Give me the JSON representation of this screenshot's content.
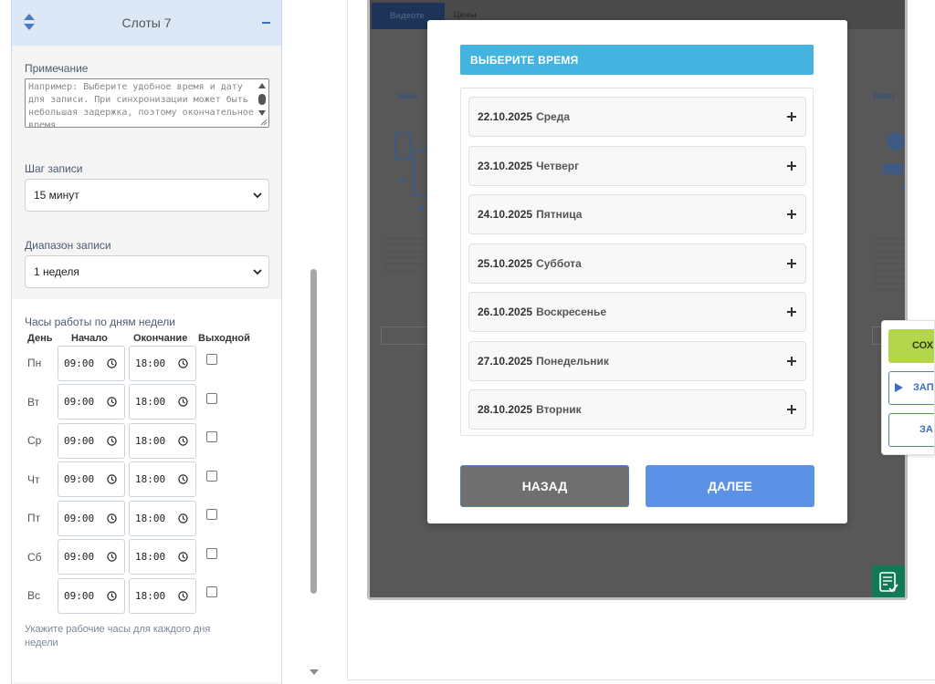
{
  "left_panel": {
    "slot_title": "Слоты 7",
    "note": {
      "label": "Примечание",
      "placeholder": "Например: Выберите удобное время и дату для записи. При синхронизации может быть небольшая задержка, поэтому окончательное время"
    },
    "step": {
      "label": "Шаг записи",
      "value": "15 минут"
    },
    "range": {
      "label": "Диапазон записи",
      "value": "1 неделя"
    },
    "hours": {
      "label": "Часы работы по дням недели",
      "columns": [
        "День",
        "Начало",
        "Окончание",
        "Выходной"
      ],
      "days": [
        {
          "day": "Пн",
          "start": "09:00",
          "end": "18:00"
        },
        {
          "day": "Вт",
          "start": "09:00",
          "end": "18:00"
        },
        {
          "day": "Ср",
          "start": "09:00",
          "end": "18:00"
        },
        {
          "day": "Чт",
          "start": "09:00",
          "end": "18:00"
        },
        {
          "day": "Пт",
          "start": "09:00",
          "end": "18:00"
        },
        {
          "day": "Сб",
          "start": "09:00",
          "end": "18:00"
        },
        {
          "day": "Вс",
          "start": "09:00",
          "end": "18:00"
        }
      ],
      "hint": "Укажите рабочие часы для каждого дня недели"
    }
  },
  "preview": {
    "tabs": [
      "Видеоте",
      "Цены"
    ],
    "card_left_title": "Банн",
    "card_right_title": "Темат"
  },
  "modal": {
    "title": "ВЫБЕРИТЕ ВРЕМЯ",
    "dates": [
      {
        "date": "22.10.2025",
        "weekday": "Среда"
      },
      {
        "date": "23.10.2025",
        "weekday": "Четверг"
      },
      {
        "date": "24.10.2025",
        "weekday": "Пятница"
      },
      {
        "date": "25.10.2025",
        "weekday": "Суббота"
      },
      {
        "date": "26.10.2025",
        "weekday": "Воскресенье"
      },
      {
        "date": "27.10.2025",
        "weekday": "Понедельник"
      },
      {
        "date": "28.10.2025",
        "weekday": "Вторник"
      }
    ],
    "back_label": "НАЗАД",
    "next_label": "ДАЛЕЕ"
  },
  "float_panel": {
    "save_label": "СОХ",
    "run_label": "ЗАП",
    "save2_label": "ЗА"
  },
  "colors": {
    "accent_blue": "#5b92e5",
    "title_blue": "#44b3e0",
    "save_green": "#b3d64b",
    "dark_green": "#0f7a55"
  }
}
